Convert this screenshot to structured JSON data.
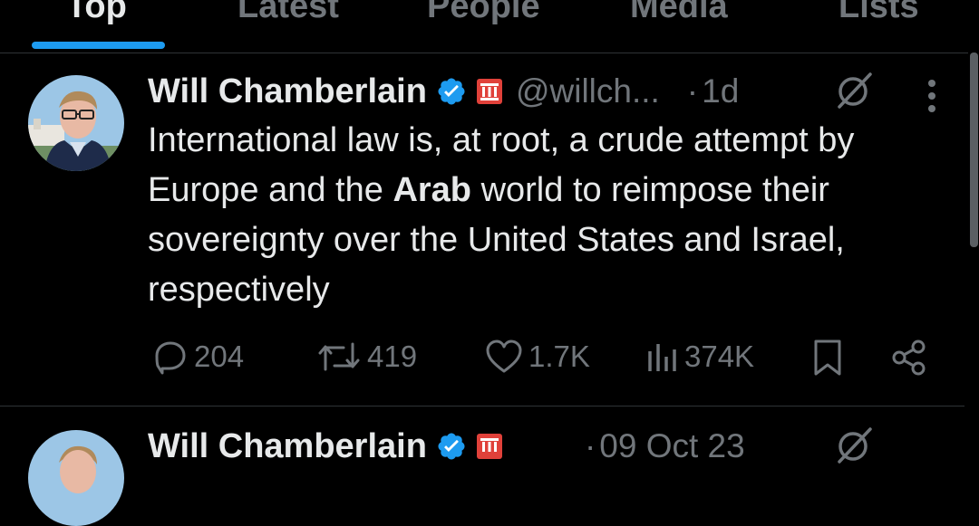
{
  "tabs": [
    {
      "label": "Top",
      "active": true
    },
    {
      "label": "Latest",
      "active": false
    },
    {
      "label": "People",
      "active": false
    },
    {
      "label": "Media",
      "active": false
    },
    {
      "label": "Lists",
      "active": false
    }
  ],
  "tweets": [
    {
      "author_name": "Will Chamberlain",
      "handle": "@willch...",
      "separator": "·",
      "time": "1d",
      "text_before": "International law is, at root, a crude attempt by Europe and the ",
      "text_bold": "Arab",
      "text_after": " world to reimpose their sovereignty over the United States and Israel, respectively",
      "replies": "204",
      "reposts": "419",
      "likes": "1.7K",
      "views": "374K"
    },
    {
      "author_name": "Will Chamberlain",
      "separator": "·",
      "time": "09 Oct 23"
    }
  ],
  "icons": {
    "verified": "verified-badge-icon",
    "affiliation": "affiliation-badge-icon",
    "grok": "grok-icon",
    "more": "more-options-icon",
    "reply": "reply-icon",
    "repost": "repost-icon",
    "like": "heart-icon",
    "views": "views-icon",
    "bookmark": "bookmark-icon",
    "share": "share-icon"
  },
  "colors": {
    "accent": "#1d9bf0",
    "text": "#e7e9ea",
    "muted": "#71767b",
    "affiliation_red": "#e0413a"
  }
}
